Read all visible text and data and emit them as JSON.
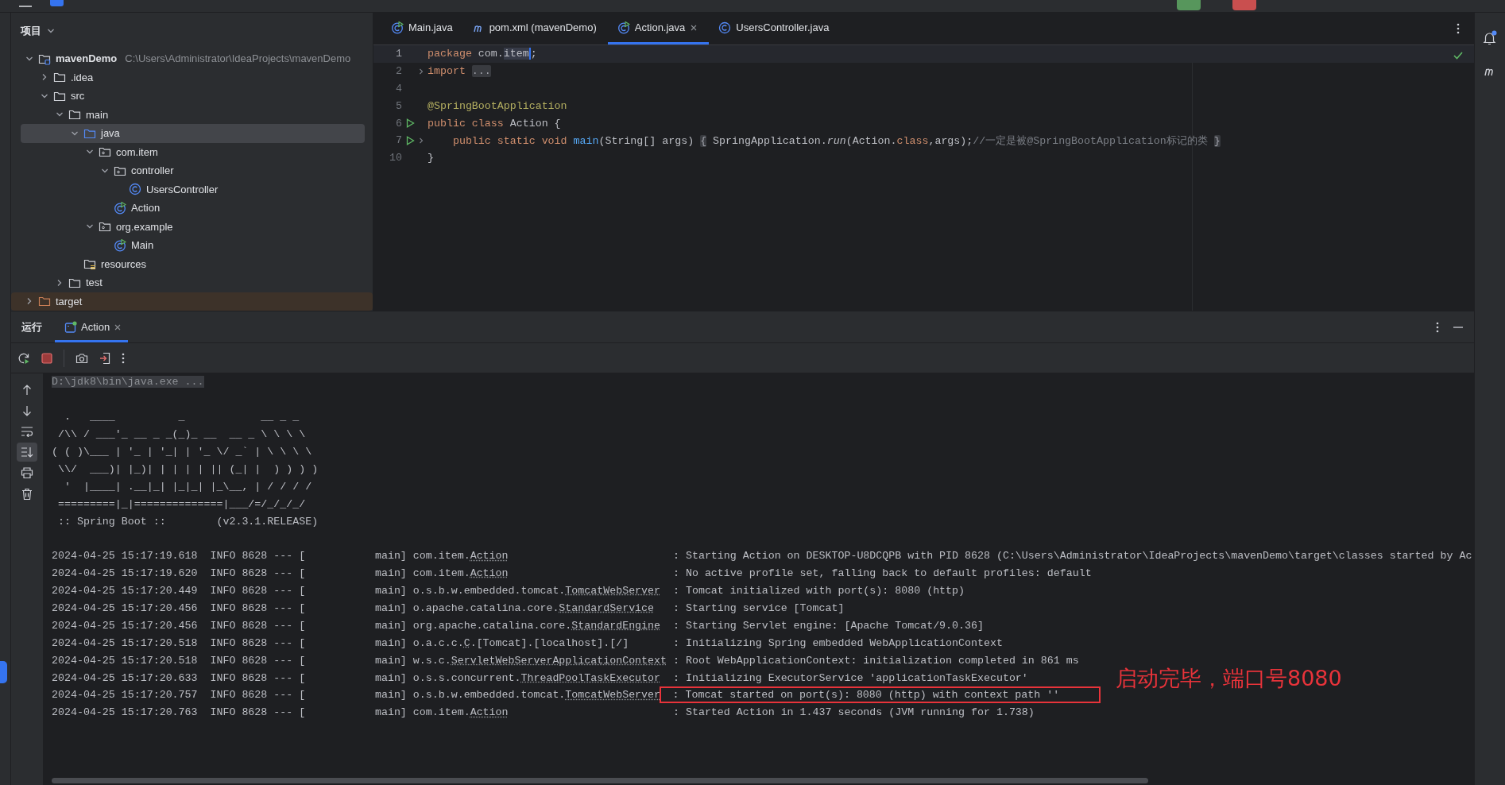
{
  "project_panel": {
    "title": "项目",
    "tree": [
      {
        "label": "mavenDemo",
        "path": "C:\\Users\\Administrator\\IdeaProjects\\mavenDemo",
        "kind": "module",
        "expanded": true,
        "selected": false,
        "children": [
          {
            "label": ".idea",
            "kind": "folder",
            "expanded": false,
            "selected": false
          },
          {
            "label": "src",
            "kind": "folder",
            "expanded": true,
            "selected": false,
            "children": [
              {
                "label": "main",
                "kind": "folder",
                "expanded": true,
                "selected": false,
                "children": [
                  {
                    "label": "java",
                    "kind": "source_folder",
                    "expanded": true,
                    "selected": true,
                    "children": [
                      {
                        "label": "com.item",
                        "kind": "package",
                        "expanded": true,
                        "selected": false,
                        "children": [
                          {
                            "label": "controller",
                            "kind": "package",
                            "expanded": true,
                            "selected": false,
                            "children": [
                              {
                                "label": "UsersController",
                                "kind": "class",
                                "selected": false
                              }
                            ]
                          },
                          {
                            "label": "Action",
                            "kind": "runnable_class",
                            "selected": false
                          }
                        ]
                      },
                      {
                        "label": "org.example",
                        "kind": "package",
                        "expanded": true,
                        "selected": false,
                        "children": [
                          {
                            "label": "Main",
                            "kind": "runnable_class",
                            "selected": false
                          }
                        ]
                      }
                    ]
                  },
                  {
                    "label": "resources",
                    "kind": "resources_folder",
                    "selected": false
                  }
                ]
              },
              {
                "label": "test",
                "kind": "folder",
                "expanded": false,
                "selected": false
              }
            ]
          },
          {
            "label": "target",
            "kind": "excluded_folder",
            "expanded": false,
            "selected": false
          }
        ]
      }
    ]
  },
  "editor": {
    "tabs": [
      {
        "label": "Main.java",
        "kind": "runnable_class",
        "selected": false,
        "closable": false
      },
      {
        "label": "pom.xml (mavenDemo)",
        "kind": "maven",
        "selected": false,
        "closable": false
      },
      {
        "label": "Action.java",
        "kind": "runnable_class",
        "selected": true,
        "closable": true
      },
      {
        "label": "UsersController.java",
        "kind": "class",
        "selected": false,
        "closable": false
      }
    ],
    "lines": [
      {
        "number": "1",
        "current": true,
        "run_marker": false,
        "folded": false,
        "tokens": [
          {
            "text": "package",
            "kind": "keyword"
          },
          {
            "text": " com.",
            "kind": "plain"
          },
          {
            "text": "item",
            "kind": "highlight"
          },
          {
            "text": ";",
            "kind": "plain"
          }
        ]
      },
      {
        "number": "2",
        "current": false,
        "run_marker": false,
        "folded": true,
        "tokens": [
          {
            "text": "import ",
            "kind": "keyword"
          },
          {
            "text": "...",
            "kind": "fold"
          }
        ]
      },
      {
        "number": "4",
        "current": false,
        "run_marker": false,
        "folded": false
      },
      {
        "number": "5",
        "current": false,
        "run_marker": false,
        "folded": false,
        "tokens": [
          {
            "text": "@SpringBootApplication",
            "kind": "annotation"
          }
        ]
      },
      {
        "number": "6",
        "current": false,
        "run_marker": true,
        "folded": false,
        "tokens": [
          {
            "text": "public class",
            "kind": "keyword"
          },
          {
            "text": " Action {",
            "kind": "plain"
          }
        ]
      },
      {
        "number": "7",
        "current": false,
        "run_marker": true,
        "folded": true,
        "tokens": [
          {
            "text": "    public static void ",
            "kind": "keyword"
          },
          {
            "text": "main",
            "kind": "method"
          },
          {
            "text": "(String[] args) ",
            "kind": "plain"
          },
          {
            "text": "{",
            "kind": "fold"
          },
          {
            "text": " SpringApplication.",
            "kind": "plain"
          },
          {
            "text": "run",
            "kind": "static_call"
          },
          {
            "text": "(Action.",
            "kind": "plain"
          },
          {
            "text": "class",
            "kind": "keyword"
          },
          {
            "text": ",args);",
            "kind": "plain"
          },
          {
            "text": "//一定是被@SpringBootApplication标记的类 ",
            "kind": "comment"
          },
          {
            "text": "}",
            "kind": "fold"
          }
        ]
      },
      {
        "number": "10",
        "current": false,
        "run_marker": false,
        "folded": false,
        "tokens": [
          {
            "text": "}",
            "kind": "plain"
          }
        ]
      }
    ]
  },
  "run_panel": {
    "title": "运行",
    "tabs": [
      {
        "label": "Action",
        "selected": true
      }
    ],
    "command": "D:\\jdk8\\bin\\java.exe ...",
    "banner": [
      "  .   ____          _            __ _ _",
      " /\\\\ / ___'_ __ _ _(_)_ __  __ _ \\ \\ \\ \\",
      "( ( )\\___ | '_ | '_| | '_ \\/ _` | \\ \\ \\ \\",
      " \\\\/  ___)| |_)| | | | | || (_| |  ) ) ) )",
      "  '  |____| .__|_| |_|_| |_\\__, | / / / /",
      " =========|_|==============|___/=/_/_/_/",
      " :: Spring Boot ::        (v2.3.1.RELEASE)"
    ],
    "log": [
      {
        "prefix": "2024-04-25 15:17:19.618  INFO 8628 --- [           main]",
        "logger": [
          {
            "text": "com.item.",
            "link": false
          },
          {
            "text": "Action",
            "link": true
          }
        ],
        "message": ": Starting Action on DESKTOP-U8DCQPB with PID 8628 (C:\\Users\\Administrator\\IdeaProjects\\mavenDemo\\target\\classes started by Ac"
      },
      {
        "prefix": "2024-04-25 15:17:19.620  INFO 8628 --- [           main]",
        "logger": [
          {
            "text": "com.item.",
            "link": false
          },
          {
            "text": "Action",
            "link": true
          }
        ],
        "message": ": No active profile set, falling back to default profiles: default"
      },
      {
        "prefix": "2024-04-25 15:17:20.449  INFO 8628 --- [           main]",
        "logger": [
          {
            "text": "o.s.b.w.embedded.tomcat.",
            "link": false
          },
          {
            "text": "TomcatWebServer",
            "link": true
          }
        ],
        "message": ": Tomcat initialized with port(s): 8080 (http)"
      },
      {
        "prefix": "2024-04-25 15:17:20.456  INFO 8628 --- [           main]",
        "logger": [
          {
            "text": "o.apache.catalina.core.",
            "link": false
          },
          {
            "text": "StandardService",
            "link": true
          }
        ],
        "message": ": Starting service [Tomcat]"
      },
      {
        "prefix": "2024-04-25 15:17:20.456  INFO 8628 --- [           main]",
        "logger": [
          {
            "text": "org.apache.catalina.core.",
            "link": false
          },
          {
            "text": "StandardEngine",
            "link": true
          }
        ],
        "message": ": Starting Servlet engine: [Apache Tomcat/9.0.36]"
      },
      {
        "prefix": "2024-04-25 15:17:20.518  INFO 8628 --- [           main]",
        "logger": [
          {
            "text": "o.a.c.c.",
            "link": false
          },
          {
            "text": "C",
            "link": true
          },
          {
            "text": ".[Tomcat].[localhost].[/]",
            "link": false
          }
        ],
        "message": ": Initializing Spring embedded WebApplicationContext"
      },
      {
        "prefix": "2024-04-25 15:17:20.518  INFO 8628 --- [           main]",
        "logger": [
          {
            "text": "w.s.c.",
            "link": false
          },
          {
            "text": "ServletWebServerApplicationContext",
            "link": true
          }
        ],
        "message": ": Root WebApplicationContext: initialization completed in 861 ms"
      },
      {
        "prefix": "2024-04-25 15:17:20.633  INFO 8628 --- [           main]",
        "logger": [
          {
            "text": "o.s.s.concurrent.",
            "link": false
          },
          {
            "text": "ThreadPoolTaskExecutor",
            "link": true
          }
        ],
        "message": ": Initializing ExecutorService 'applicationTaskExecutor'"
      },
      {
        "prefix": "2024-04-25 15:17:20.757  INFO 8628 --- [           main]",
        "logger": [
          {
            "text": "o.s.b.w.embedded.tomcat.",
            "link": false
          },
          {
            "text": "TomcatWebServer",
            "link": true
          }
        ],
        "message": ": Tomcat started on port(s): 8080 (http) with context path ''",
        "highlighted": true
      },
      {
        "prefix": "2024-04-25 15:17:20.763  INFO 8628 --- [           main]",
        "logger": [
          {
            "text": "com.item.",
            "link": false
          },
          {
            "text": "Action",
            "link": true
          }
        ],
        "message": ": Started Action in 1.437 seconds (JVM running for 1.738)"
      }
    ]
  },
  "annotation": {
    "text": "启动完毕，端口号8080"
  }
}
